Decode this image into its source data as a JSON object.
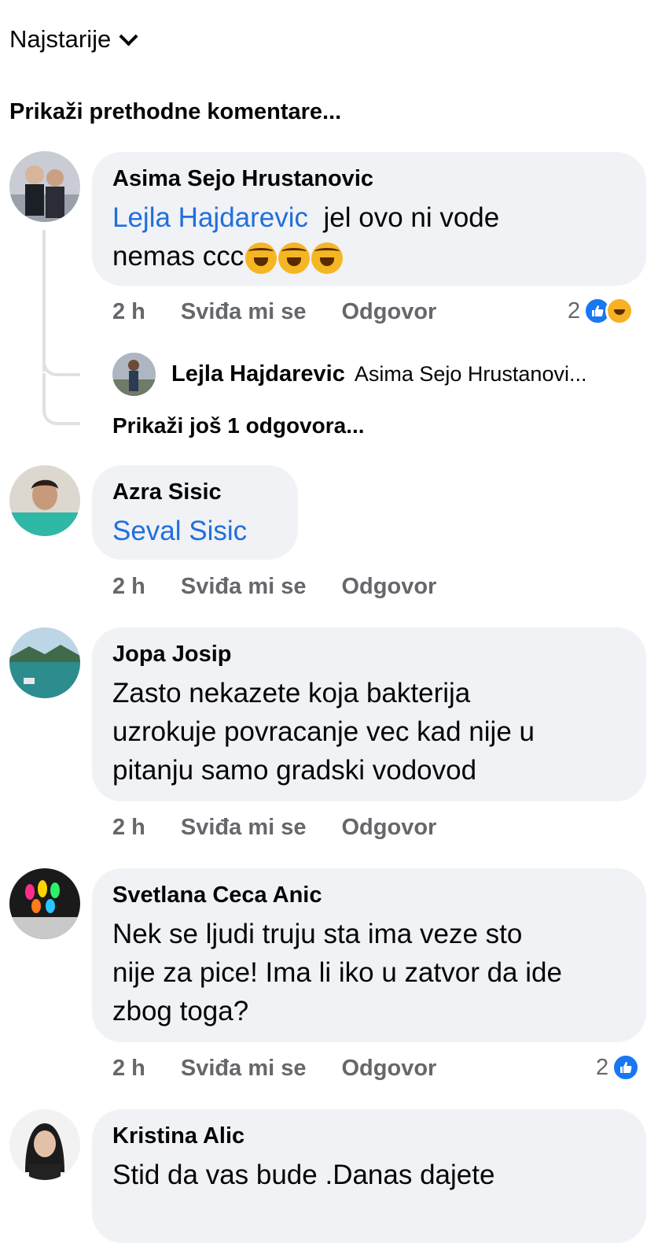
{
  "sort": {
    "label": "Najstarije",
    "icon": "chevron-down-icon"
  },
  "show_previous": "Prikaži prethodne komentare...",
  "actions": {
    "like": "Sviđa mi se",
    "reply": "Odgovor"
  },
  "comments": [
    {
      "author": "Asima Sejo Hrustanovic",
      "mention": "Lejla Hajdarevic",
      "text_line1": "jel ovo ni vode",
      "text_line2": "nemas ccc",
      "emojis": [
        "rolling-on-floor-laughing-icon",
        "rolling-on-floor-laughing-icon",
        "rolling-on-floor-laughing-icon"
      ],
      "time": "2 h",
      "reaction_count": "2",
      "reactions": [
        "like-icon",
        "haha-icon"
      ],
      "reply": {
        "author": "Lejla Hajdarevic",
        "text": "Asima Sejo Hrustanovi..."
      },
      "more_replies": "Prikaži još 1 odgovora..."
    },
    {
      "author": "Azra Sisic",
      "mention": "Seval Sisic",
      "time": "2 h"
    },
    {
      "author": "Jopa Josip",
      "lines": [
        "Zasto nekazete koja bakterija",
        "uzrokuje povracanje vec kad nije u",
        "pitanju samo gradski vodovod"
      ],
      "time": "2 h"
    },
    {
      "author": "Svetlana Ceca Anic",
      "lines": [
        "Nek se ljudi truju sta ima veze sto",
        "nije za pice! Ima li iko u zatvor da ide",
        "zbog toga?"
      ],
      "time": "2 h",
      "reaction_count": "2",
      "reactions": [
        "like-icon"
      ]
    },
    {
      "author": "Kristina Alic",
      "lines": [
        "Stid da vas bude .Danas dajete"
      ]
    }
  ],
  "colors": {
    "mention": "#216fdb",
    "bubble": "#f0f2f5",
    "meta": "#65676b",
    "like": "#1877f2"
  }
}
